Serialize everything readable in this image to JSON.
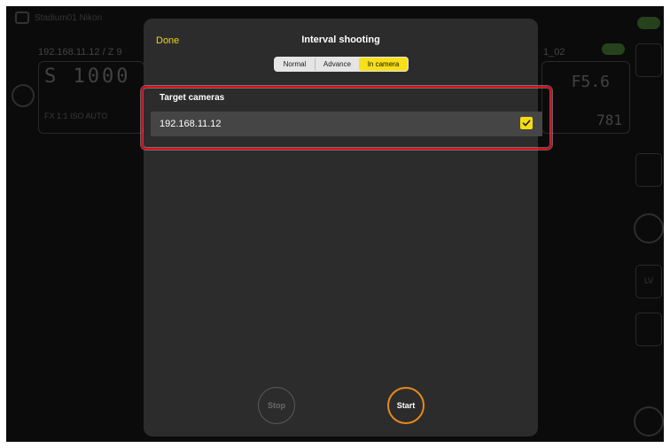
{
  "background": {
    "camera_name": "Stadium01 Nikon",
    "left_ip": "192.168.11.12 / Z 9",
    "left_shutter": "S 1000",
    "left_status": "FX 1:1 ISO AUTO",
    "right_label": "1_02",
    "right_fstop": "F5.6",
    "right_count": "781",
    "side_lv": "LV"
  },
  "sheet": {
    "done_label": "Done",
    "title": "Interval shooting",
    "segments": [
      {
        "label": "Normal",
        "selected": false
      },
      {
        "label": "Advance",
        "selected": false
      },
      {
        "label": "In camera",
        "selected": true
      }
    ],
    "section_title": "Target cameras",
    "target": {
      "ip": "192.168.11.12",
      "checked": true
    },
    "stop_label": "Stop",
    "start_label": "Start"
  },
  "colors": {
    "accent_yellow": "#f8df1a",
    "start_ring": "#e8891d",
    "highlight": "#e60012",
    "sheet_bg": "#2c2c2c"
  },
  "icons": {
    "check": "check-icon",
    "camera": "camera-icon"
  }
}
